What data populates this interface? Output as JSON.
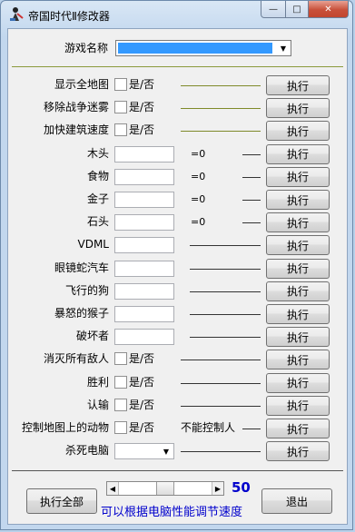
{
  "window": {
    "title": "帝国时代Ⅱ修改器",
    "controls": {
      "minimize": "—",
      "maximize": "□",
      "close": "✕"
    }
  },
  "game_select": {
    "label": "游戏名称",
    "selected": ""
  },
  "toggle_rows": [
    {
      "label": "显示全地图",
      "option": "是/否",
      "button": "执行"
    },
    {
      "label": "移除战争迷雾",
      "option": "是/否",
      "button": "执行"
    },
    {
      "label": "加快建筑速度",
      "option": "是/否",
      "button": "执行"
    }
  ],
  "resource_rows": [
    {
      "label": "木头",
      "value": "",
      "suffix": "=0",
      "button": "执行"
    },
    {
      "label": "食物",
      "value": "",
      "suffix": "=0",
      "button": "执行"
    },
    {
      "label": "金子",
      "value": "",
      "suffix": "=0",
      "button": "执行"
    },
    {
      "label": "石头",
      "value": "",
      "suffix": "=0",
      "button": "执行"
    }
  ],
  "unit_rows": [
    {
      "label": "VDML",
      "value": "",
      "button": "执行"
    },
    {
      "label": "眼镜蛇汽车",
      "value": "",
      "button": "执行"
    },
    {
      "label": "飞行的狗",
      "value": "",
      "button": "执行"
    },
    {
      "label": "暴怒的猴子",
      "value": "",
      "button": "执行"
    },
    {
      "label": "破坏者",
      "value": "",
      "button": "执行"
    }
  ],
  "action_rows": [
    {
      "label": "消灭所有敌人",
      "option": "是/否",
      "note": "",
      "button": "执行"
    },
    {
      "label": "胜利",
      "option": "是/否",
      "note": "",
      "button": "执行"
    },
    {
      "label": "认输",
      "option": "是/否",
      "note": "",
      "button": "执行"
    },
    {
      "label": "控制地图上的动物",
      "option": "是/否",
      "note": "不能控制人",
      "button": "执行"
    }
  ],
  "kill_ai": {
    "label": "杀死电脑",
    "selected": "",
    "button": "执行"
  },
  "footer": {
    "run_all": "执行全部",
    "speed_value": "50",
    "speed_fraction": 0.5,
    "hint": "可以根据电脑性能调节速度",
    "exit": "退出"
  }
}
